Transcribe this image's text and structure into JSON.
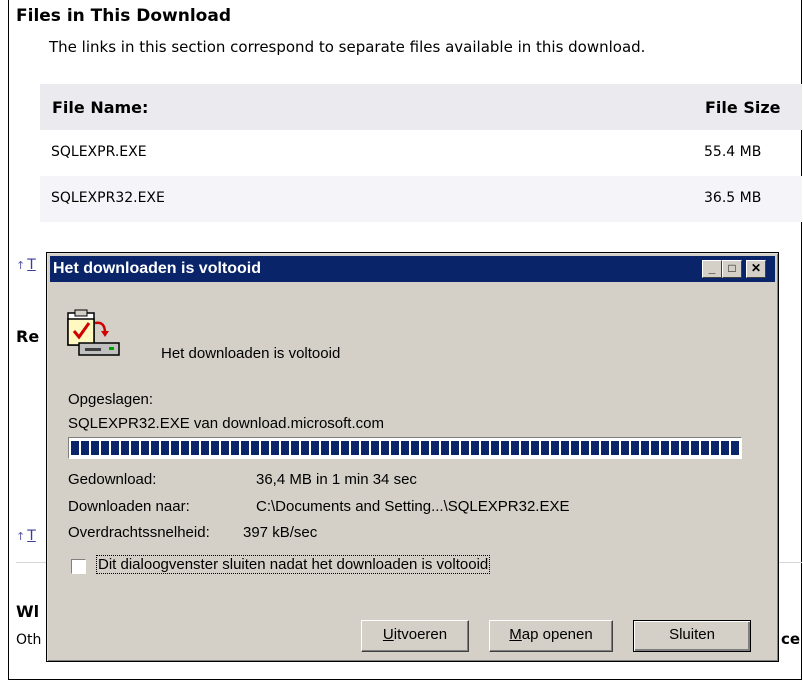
{
  "page": {
    "section_title": "Files in This Download",
    "section_desc": "The links in this section correspond to separate files available in this download.",
    "files_header": {
      "name": "File Name:",
      "size": "File Size"
    },
    "files": [
      {
        "name": "SQLEXPR.EXE",
        "size": "55.4 MB"
      },
      {
        "name": "SQLEXPR32.EXE",
        "size": "36.5 MB"
      }
    ],
    "top_link_arrow": "↑",
    "top_link_text": "T",
    "fragment_re": "Re",
    "fragment_wi": "Wl",
    "fragment_oth": "Oth",
    "fragment_ce": "ce"
  },
  "dialog": {
    "title": "Het downloaden is voltooid",
    "title_buttons": {
      "minimize": "_",
      "maximize": "□",
      "close": "✕"
    },
    "icon": "download-complete-icon",
    "heading": "Het downloaden is voltooid",
    "saved_label": "Opgeslagen:",
    "saved_value": "SQLEXPR32.EXE van download.microsoft.com",
    "progress_fraction": 1.0,
    "downloaded_label": "Gedownload:",
    "downloaded_value": "36,4 MB in 1 min 34 sec",
    "dest_label": "Downloaden naar:",
    "dest_value": "C:\\Documents and Setting...\\SQLEXPR32.EXE",
    "rate_label": "Overdrachtssnelheid:",
    "rate_value": "397 kB/sec",
    "checkbox_label": "Dit dialoogvenster sluiten nadat het downloaden is voltooid",
    "checkbox_checked": false,
    "buttons": {
      "run_u": "U",
      "run_rest": "itvoeren",
      "open_u": "M",
      "open_rest": "ap openen",
      "close": "Sluiten"
    }
  },
  "colors": {
    "titlebar": "#0a246a",
    "dialog_bg": "#d4d0c8",
    "link": "#3b3b9e"
  }
}
